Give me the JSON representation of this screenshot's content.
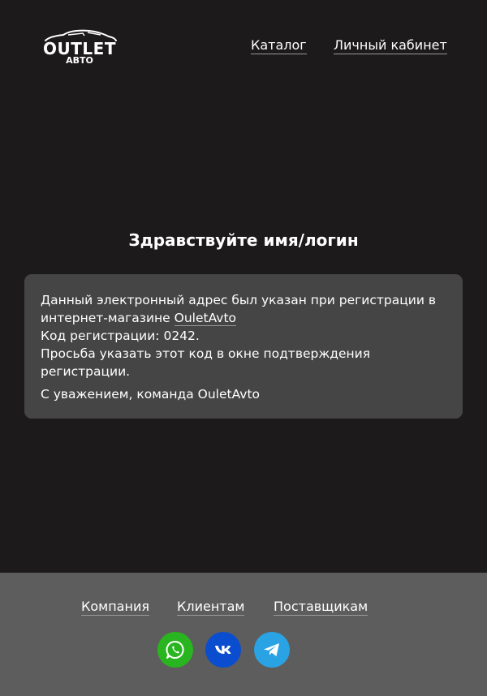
{
  "header": {
    "logo_main": "OUTLET",
    "logo_sub": "АВТО",
    "nav": {
      "catalog": "Каталог",
      "cabinet": "Личный кабинет"
    }
  },
  "greeting": "Здравствуйте имя/логин",
  "message": {
    "line1_prefix": "Данный электронный адрес был указан при регистрации в интернет-магазине ",
    "shop_link": "OuletAvto",
    "code_line": "Код регистрации: 0242.",
    "request_line": "Просьба указать этот код в окне подтверждения регистрации.",
    "signature": "С уважением, команда OuletAvto"
  },
  "footer": {
    "links": {
      "company": "Компания",
      "clients": "Клиентам",
      "suppliers": "Поставщикам"
    },
    "social": [
      {
        "icon": "whatsapp-icon",
        "color": "#29b51f"
      },
      {
        "icon": "vk-icon",
        "color": "#0a4ecf"
      },
      {
        "icon": "telegram-icon",
        "color": "#2aa3e4"
      }
    ]
  },
  "colors": {
    "background": "#1c1a1b",
    "card": "#464546",
    "footer": "#5e5d5d"
  }
}
